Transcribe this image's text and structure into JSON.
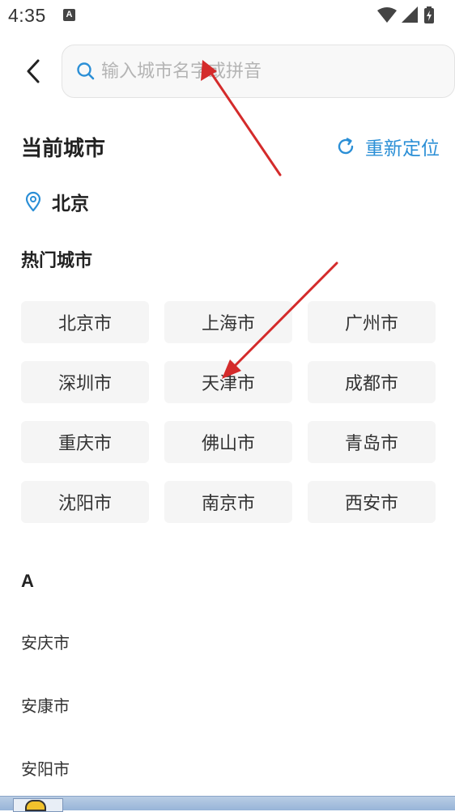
{
  "status_bar": {
    "time": "4:35",
    "notification_letter": "A",
    "icons": [
      "wifi-icon",
      "signal-icon",
      "battery-charging-icon"
    ]
  },
  "header": {
    "back_icon": "chevron-left-icon",
    "search": {
      "placeholder": "输入城市名字或拼音",
      "value": "",
      "icon": "search-icon"
    }
  },
  "current_city": {
    "title": "当前城市",
    "relocate_label": "重新定位",
    "relocate_icon": "refresh-icon",
    "location_icon": "location-pin-icon",
    "city": "北京"
  },
  "hot_cities": {
    "title": "热门城市",
    "items": [
      "北京市",
      "上海市",
      "广州市",
      "深圳市",
      "天津市",
      "成都市",
      "重庆市",
      "佛山市",
      "青岛市",
      "沈阳市",
      "南京市",
      "西安市"
    ]
  },
  "city_index": {
    "letter": "A",
    "items": [
      "安庆市",
      "安康市",
      "安阳市"
    ]
  },
  "colors": {
    "accent": "#2b8fd6",
    "tile_background": "#f5f5f5",
    "annotation_arrow": "#d42b2b"
  }
}
